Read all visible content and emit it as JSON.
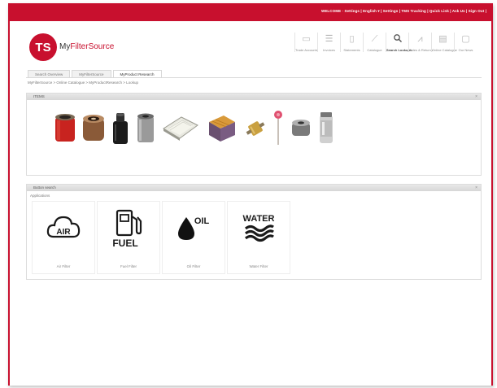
{
  "topbar": {
    "links": "WELCOME · Settings | English ▾ | Settings | TMS Tracking | Quick Link | Ask Us | Sign Out |"
  },
  "logo": {
    "initials": "TS",
    "my": "My",
    "brand": "FilterSource"
  },
  "toolbar": [
    {
      "icon": "book-icon",
      "label": "Trade Accounts"
    },
    {
      "icon": "list-icon",
      "label": "Invoices"
    },
    {
      "icon": "calendar-icon",
      "label": "Statements"
    },
    {
      "icon": "chart-icon",
      "label": "Catalogue"
    },
    {
      "icon": "search-icon",
      "label": "Search Lookups"
    },
    {
      "icon": "graph-icon",
      "label": "Sales & Returns"
    },
    {
      "icon": "catalog-icon",
      "label": "Online Catalogue"
    },
    {
      "icon": "file-icon",
      "label": "Our News"
    }
  ],
  "tabs": [
    {
      "label": "Search Overview",
      "active": false
    },
    {
      "label": "MyFilterSource",
      "active": false
    },
    {
      "label": "MyProduct Research",
      "active": true
    }
  ],
  "breadcrumb": "MyFilterSource > Online Catalogue > MyProductResearch > Lookup",
  "panel_products": {
    "title": "ITEMS",
    "close": "×",
    "items": [
      {
        "name": "oil-filter-red-product"
      },
      {
        "name": "spin-on-filter-product"
      },
      {
        "name": "black-oil-filter-product"
      },
      {
        "name": "grey-filter-canister-product"
      },
      {
        "name": "cabin-air-filter-product"
      },
      {
        "name": "panel-air-filter-product"
      },
      {
        "name": "inline-fuel-filter-product"
      },
      {
        "name": "dipstick-filter-product"
      },
      {
        "name": "round-filter-element-product"
      },
      {
        "name": "fuel-filter-canister-product"
      }
    ]
  },
  "panel_search": {
    "title": "Button search",
    "close": "×",
    "subheading": "Applications",
    "filters": [
      {
        "name": "air",
        "icon_text": "AIR",
        "label": "Air Filter"
      },
      {
        "name": "fuel",
        "icon_text": "FUEL",
        "label": "Fuel Filter"
      },
      {
        "name": "oil",
        "icon_text": "OIL",
        "label": "Oil Filter"
      },
      {
        "name": "water",
        "icon_text": "WATER",
        "label": "Water Filter"
      }
    ]
  }
}
